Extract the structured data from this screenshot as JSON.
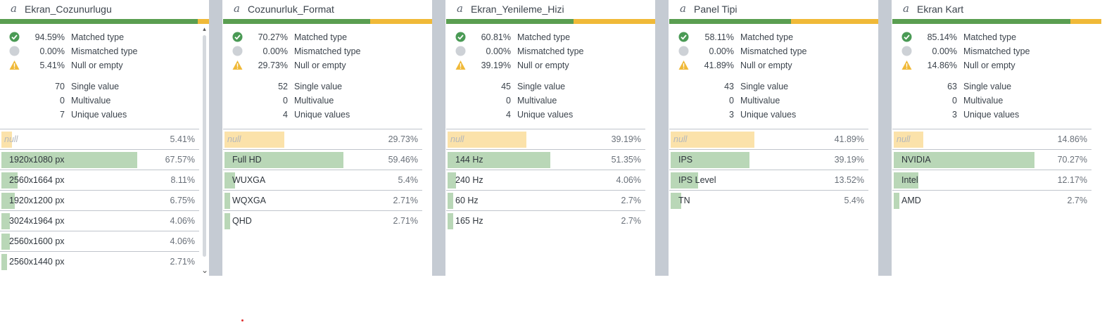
{
  "colors": {
    "matched": "#5a9e51",
    "null": "#f0b938",
    "gap": "#c5cbd3"
  },
  "columns": [
    {
      "name": "Ekran_Cozunurlugu",
      "type_icon": "a",
      "matched_pct": 94.59,
      "matched": "94.59%",
      "mismatched": "0.00%",
      "nullval": "5.41%",
      "single": "70",
      "multi": "0",
      "unique": "7",
      "labels": {
        "matched": "Matched type",
        "mismatched": "Mismatched type",
        "nullval": "Null or empty",
        "single": "Single value",
        "multi": "Multivalue",
        "unique": "Unique values"
      },
      "values": [
        {
          "label": "null",
          "pct": "5.41%",
          "frac": 0.0541,
          "is_null": true
        },
        {
          "label": "1920x1080 px",
          "pct": "67.57%",
          "frac": 0.6757
        },
        {
          "label": "2560x1664 px",
          "pct": "8.11%",
          "frac": 0.0811
        },
        {
          "label": "1920x1200 px",
          "pct": "6.75%",
          "frac": 0.0675
        },
        {
          "label": "3024x1964 px",
          "pct": "4.06%",
          "frac": 0.0406
        },
        {
          "label": "2560x1600 px",
          "pct": "4.06%",
          "frac": 0.0406
        },
        {
          "label": "2560x1440 px",
          "pct": "2.71%",
          "frac": 0.0271
        }
      ],
      "scrollbar": true
    },
    {
      "name": "Cozunurluk_Format",
      "type_icon": "a",
      "matched_pct": 70.27,
      "matched": "70.27%",
      "mismatched": "0.00%",
      "nullval": "29.73%",
      "single": "52",
      "multi": "0",
      "unique": "4",
      "labels": {
        "matched": "Matched type",
        "mismatched": "Mismatched type",
        "nullval": "Null or empty",
        "single": "Single value",
        "multi": "Multivalue",
        "unique": "Unique values"
      },
      "values": [
        {
          "label": "null",
          "pct": "29.73%",
          "frac": 0.2973,
          "is_null": true
        },
        {
          "label": "Full HD",
          "pct": "59.46%",
          "frac": 0.5946
        },
        {
          "label": "WUXGA",
          "pct": "5.4%",
          "frac": 0.054
        },
        {
          "label": "WQXGA",
          "pct": "2.71%",
          "frac": 0.0271
        },
        {
          "label": "QHD",
          "pct": "2.71%",
          "frac": 0.0271
        }
      ]
    },
    {
      "name": "Ekran_Yenileme_Hizi",
      "type_icon": "a",
      "matched_pct": 60.81,
      "matched": "60.81%",
      "mismatched": "0.00%",
      "nullval": "39.19%",
      "single": "45",
      "multi": "0",
      "unique": "4",
      "labels": {
        "matched": "Matched type",
        "mismatched": "Mismatched type",
        "nullval": "Null or empty",
        "single": "Single value",
        "multi": "Multivalue",
        "unique": "Unique values"
      },
      "values": [
        {
          "label": "null",
          "pct": "39.19%",
          "frac": 0.3919,
          "is_null": true
        },
        {
          "label": "144 Hz",
          "pct": "51.35%",
          "frac": 0.5135
        },
        {
          "label": "240 Hz",
          "pct": "4.06%",
          "frac": 0.0406
        },
        {
          "label": "60 Hz",
          "pct": "2.7%",
          "frac": 0.027
        },
        {
          "label": "165 Hz",
          "pct": "2.7%",
          "frac": 0.027
        }
      ]
    },
    {
      "name": "Panel Tipi",
      "type_icon": "a",
      "matched_pct": 58.11,
      "matched": "58.11%",
      "mismatched": "0.00%",
      "nullval": "41.89%",
      "single": "43",
      "multi": "0",
      "unique": "3",
      "labels": {
        "matched": "Matched type",
        "mismatched": "Mismatched type",
        "nullval": "Null or empty",
        "single": "Single value",
        "multi": "Multivalue",
        "unique": "Unique values"
      },
      "values": [
        {
          "label": "null",
          "pct": "41.89%",
          "frac": 0.4189,
          "is_null": true
        },
        {
          "label": "IPS",
          "pct": "39.19%",
          "frac": 0.3919
        },
        {
          "label": "IPS Level",
          "pct": "13.52%",
          "frac": 0.1352
        },
        {
          "label": "TN",
          "pct": "5.4%",
          "frac": 0.054
        }
      ]
    },
    {
      "name": "Ekran Kart",
      "type_icon": "a",
      "matched_pct": 85.14,
      "matched": "85.14%",
      "mismatched": "0.00%",
      "nullval": "14.86%",
      "single": "63",
      "multi": "0",
      "unique": "3",
      "labels": {
        "matched": "Matched type",
        "mismatched": "Mismatched type",
        "nullval": "Null or empty",
        "single": "Single value",
        "multi": "Multivalue",
        "unique": "Unique values"
      },
      "values": [
        {
          "label": "null",
          "pct": "14.86%",
          "frac": 0.1486,
          "is_null": true
        },
        {
          "label": "NVIDIA",
          "pct": "70.27%",
          "frac": 0.7027
        },
        {
          "label": "Intel",
          "pct": "12.17%",
          "frac": 0.1217
        },
        {
          "label": "AMD",
          "pct": "2.7%",
          "frac": 0.027
        }
      ]
    }
  ]
}
